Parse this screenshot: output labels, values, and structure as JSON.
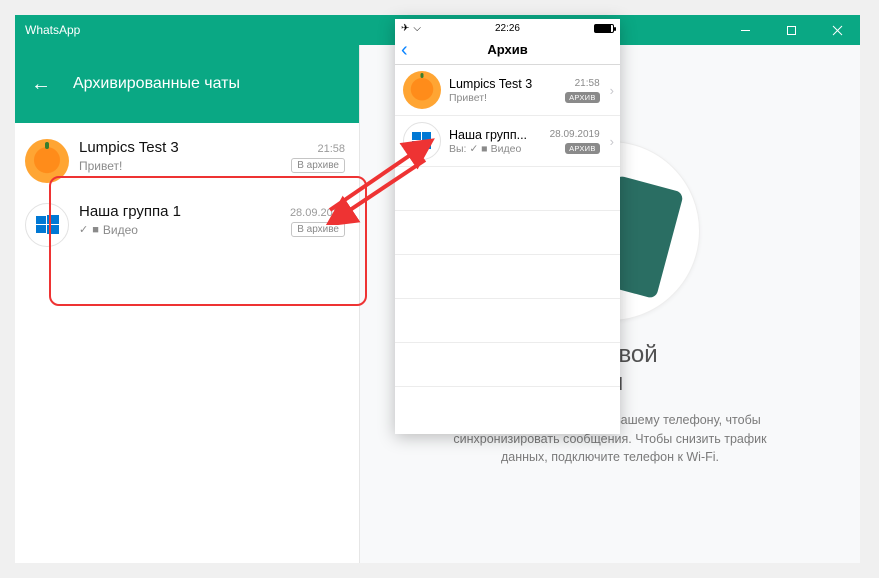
{
  "window": {
    "title": "WhatsApp"
  },
  "left_panel": {
    "header": "Архивированные чаты",
    "chats": [
      {
        "name": "Lumpics Test 3",
        "preview": "Привет!",
        "time": "21:58",
        "badge": "В архиве",
        "avatar": "orange"
      },
      {
        "name": "Наша группа 1",
        "preview_tick": "✓",
        "preview_icon": "🎥",
        "preview": "Видео",
        "time": "28.09.2019",
        "badge": "В архиве",
        "avatar": "windows"
      }
    ]
  },
  "right_panel": {
    "headline_suffix": "йте свой",
    "headline_line2_suffix": "он",
    "body": "WhatsApp подключается к вашему телефону, чтобы синхронизировать сообщения. Чтобы снизить трафик данных, подключите телефон к Wi-Fi."
  },
  "iphone": {
    "status_time": "22:26",
    "nav_title": "Архив",
    "rows": [
      {
        "name": "Lumpics Test 3",
        "preview": "Привет!",
        "time": "21:58",
        "badge": "АРХИВ",
        "avatar": "orange"
      },
      {
        "name": "Наша групп...",
        "preview_you": "Вы:",
        "preview_tick": "✓",
        "preview_icon": "🎥",
        "preview": "Видео",
        "time": "28.09.2019",
        "badge": "АРХИВ",
        "avatar": "windows"
      }
    ]
  }
}
